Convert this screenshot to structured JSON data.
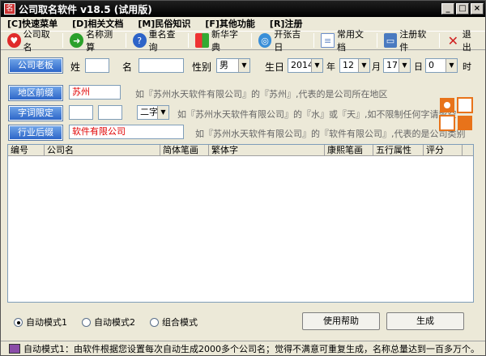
{
  "window": {
    "title": "公司取名软件 v18.5 (试用版)"
  },
  "menu": [
    "[C]快速菜单",
    "[D]相关文档",
    "[M]民俗知识",
    "[F]其他功能",
    "[R]注册"
  ],
  "toolbar": [
    {
      "label": "公司取名",
      "icon": "heart-icon",
      "color": "#e02b2b"
    },
    {
      "label": "名称测算",
      "icon": "arrow-right-icon",
      "color": "#2ba02b"
    },
    {
      "label": "重名查询",
      "icon": "help-icon",
      "color": "#2d63c8"
    },
    {
      "label": "新华字典",
      "icon": "windows-logo-icon",
      "color": "#f0a000"
    },
    {
      "label": "开张吉日",
      "icon": "globe-icon",
      "color": "#3a8fd8"
    },
    {
      "label": "常用文档",
      "icon": "document-icon",
      "color": "#6a8cc8"
    },
    {
      "label": "注册软件",
      "icon": "monitor-icon",
      "color": "#4a7ac0"
    },
    {
      "label": "退出",
      "icon": "close-icon",
      "color": "#d02020"
    }
  ],
  "form": {
    "boss_btn": "公司老板",
    "surname_label": "姓",
    "surname": "",
    "name_label": "名",
    "given_name": "",
    "gender_label": "性别",
    "gender": "男",
    "birth_label": "生日",
    "year": "2014",
    "year_unit": "年",
    "month": "12",
    "month_unit": "月",
    "day": "17",
    "day_unit": "日",
    "hour": "0",
    "hour_unit": "时",
    "region_btn": "地区前缀",
    "region_value": "苏州",
    "region_hint": "如『苏州水天软件有限公司』的『苏州』,代表的是公司所在地区",
    "char_btn": "字词限定",
    "char1": "",
    "char2": "",
    "char_count": "二字",
    "char_hint": "如『苏州水天软件有限公司』的『水』或『天』,如不限制任何字请留空",
    "industry_btn": "行业后缀",
    "industry_value": "软件有限公司",
    "industry_hint": "如『苏州水天软件有限公司』的『软件有限公司』,代表的是公司类别"
  },
  "grid": {
    "columns": [
      "编号",
      "公司名",
      "简体笔画",
      "繁体字",
      "康熙笔画",
      "五行属性",
      "评分"
    ]
  },
  "modes": [
    {
      "label": "自动模式1",
      "selected": true
    },
    {
      "label": "自动模式2",
      "selected": false
    },
    {
      "label": "组合模式",
      "selected": false
    }
  ],
  "buttons": {
    "help": "使用帮助",
    "generate": "生成"
  },
  "status": "自动模式1：由软件根据您设置每次自动生成2000多个公司名；觉得不满意可重复生成，名称总量达到一百多万个。"
}
